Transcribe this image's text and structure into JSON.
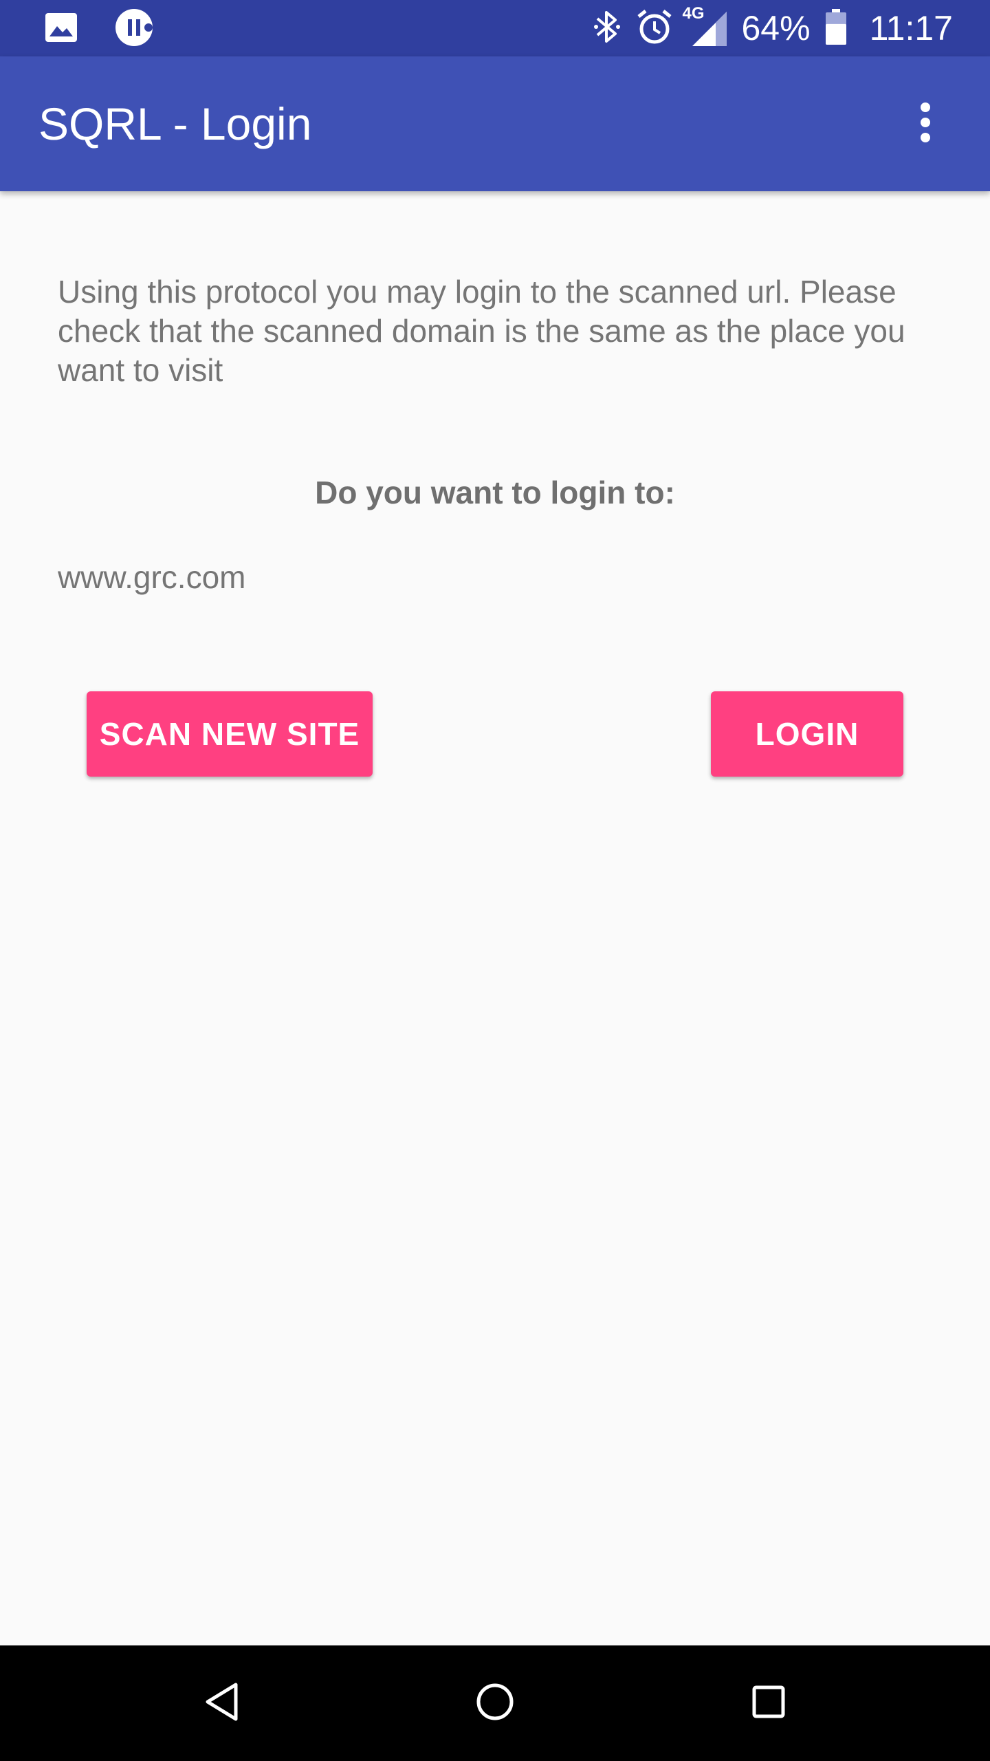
{
  "status_bar": {
    "icons_left": [
      "image-icon",
      "pause-icon"
    ],
    "icons_right": [
      "bluetooth-icon",
      "alarm-icon",
      "signal-4g-icon",
      "battery-icon"
    ],
    "network_label": "4G",
    "battery_percent": "64%",
    "battery_level": 0.64,
    "time": "11:17"
  },
  "app_bar": {
    "title": "SQRL - Login",
    "overflow_icon": "more-vert-icon"
  },
  "content": {
    "intro": "Using this protocol you may login to the scanned url. Please check that the scanned domain is the same as the place you want to visit",
    "question": "Do you want to login to:",
    "site": "www.grc.com"
  },
  "buttons": {
    "scan_new_site": "SCAN NEW SITE",
    "login": "LOGIN"
  },
  "colors": {
    "status_bar": "#303f9f",
    "app_bar": "#3f51b5",
    "accent": "#ff4081",
    "background": "#fafafa",
    "nav_bar": "#000000"
  },
  "nav_bar": {
    "icons": [
      "back-icon",
      "home-icon",
      "recents-icon"
    ]
  }
}
